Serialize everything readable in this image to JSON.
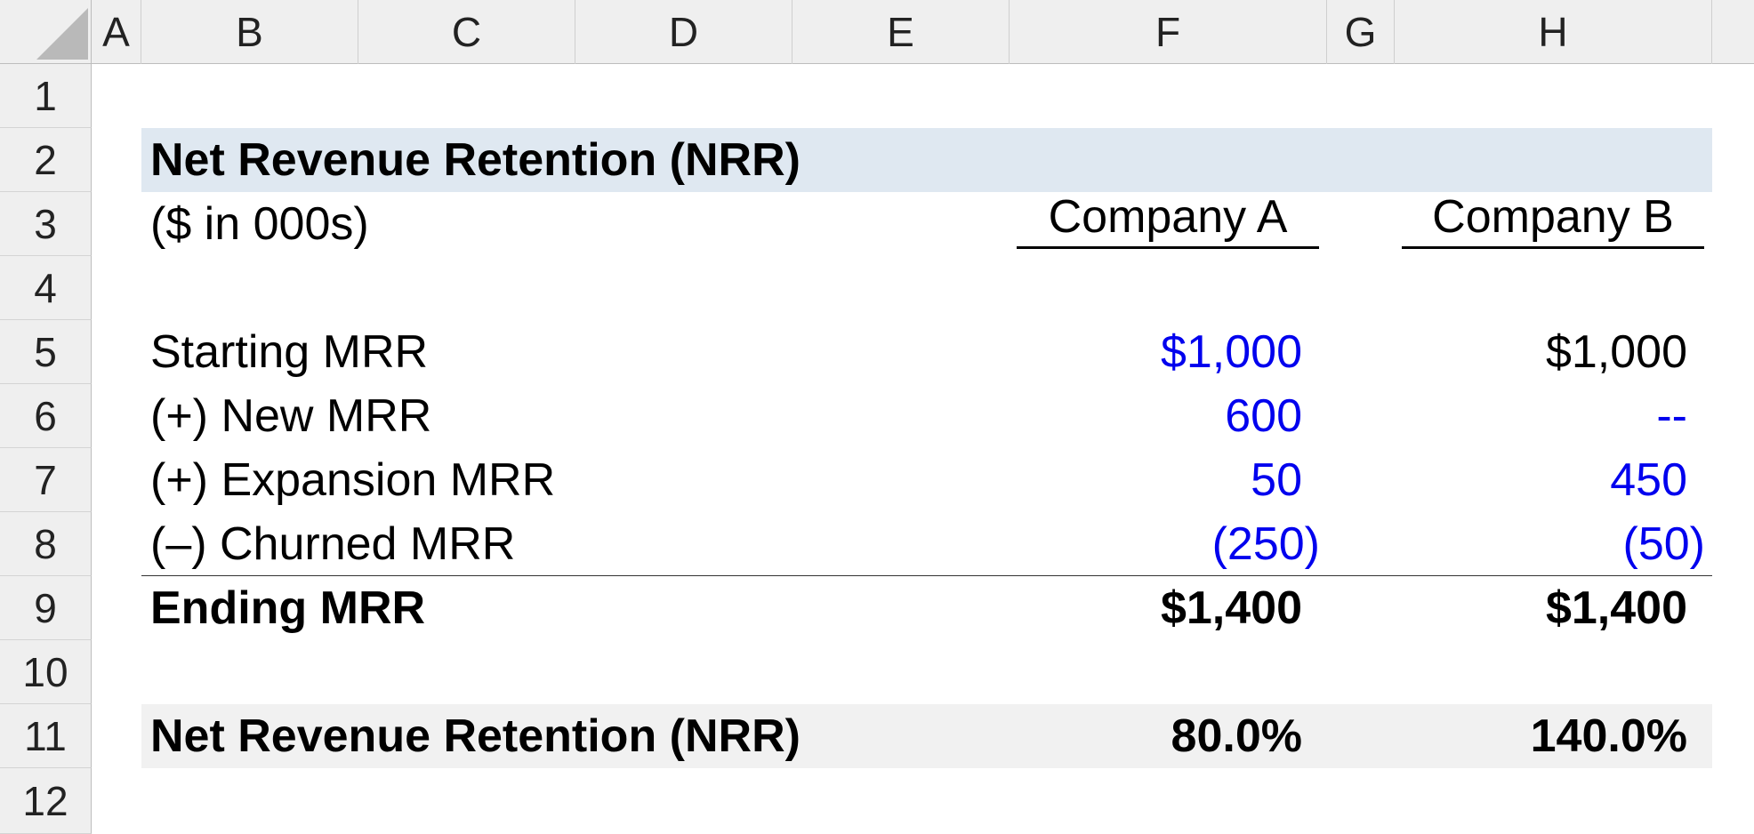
{
  "columns": [
    "A",
    "B",
    "C",
    "D",
    "E",
    "F",
    "G",
    "H"
  ],
  "rows": [
    "1",
    "2",
    "3",
    "4",
    "5",
    "6",
    "7",
    "8",
    "9",
    "10",
    "11",
    "12"
  ],
  "table": {
    "title": "Net Revenue Retention (NRR)",
    "units": "($ in 000s)",
    "company_a": "Company A",
    "company_b": "Company B",
    "lines": [
      {
        "label": "Starting MRR",
        "a": "$1,000",
        "b": "$1,000"
      },
      {
        "label": "(+) New MRR",
        "a": "600",
        "b": "--"
      },
      {
        "label": "(+) Expansion MRR",
        "a": "50",
        "b": "450"
      },
      {
        "label": "(–) Churned MRR",
        "a": "(250)",
        "b": "(50)"
      }
    ],
    "ending": {
      "label": "Ending MRR",
      "a": "$1,400",
      "b": "$1,400"
    },
    "nrr": {
      "label": "Net Revenue Retention (NRR)",
      "a": "80.0%",
      "b": "140.0%"
    }
  },
  "colors": {
    "title_fill": "#dfe8f1",
    "nrr_fill": "#f1f1f1",
    "input_blue": "#0000ee",
    "header_bg": "#efefef"
  }
}
